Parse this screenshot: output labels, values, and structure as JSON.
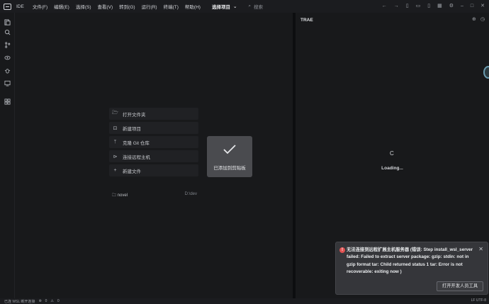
{
  "titlebar": {
    "ide_label": "IDE",
    "menu": [
      "文件(F)",
      "编辑(E)",
      "选择(S)",
      "查看(V)",
      "转到(G)",
      "运行(R)",
      "终端(T)",
      "帮助(H)"
    ],
    "project": "选择项目",
    "search_placeholder": "搜索"
  },
  "welcome": {
    "items": [
      {
        "icon": "folder-open-icon",
        "label": "打开文件夹"
      },
      {
        "icon": "new-project-icon",
        "label": "新建项目"
      },
      {
        "icon": "git-branch-icon",
        "label": "克隆 Git 仓库"
      },
      {
        "icon": "remote-terminal-icon",
        "label": "连接远程主机"
      },
      {
        "icon": "plus-icon",
        "label": "新建文件"
      }
    ],
    "recent": {
      "name": "novel",
      "path": "D:\\dev"
    }
  },
  "clipboard_toast": {
    "message": "已添加到剪贴板"
  },
  "panel": {
    "title": "TRAE",
    "spinner": "C",
    "loading": "Loading..."
  },
  "notification": {
    "message": "无法连接到远程扩展主机服务器 (错误: Step install_wsl_server failed: Failed to extract server package: gzip: stdin: not in gzip format tar: Child returned status 1 tar: Error is not recoverable: exiting now )",
    "button": "打开开发人员工具"
  },
  "statusbar": {
    "left": "已连 WSL 断开连接",
    "errors": "0",
    "warnings": "0",
    "right": "LF   UTF-8"
  },
  "colors": {
    "background": "#18191b",
    "error": "#e05252",
    "toast": "#4a4b4f"
  }
}
